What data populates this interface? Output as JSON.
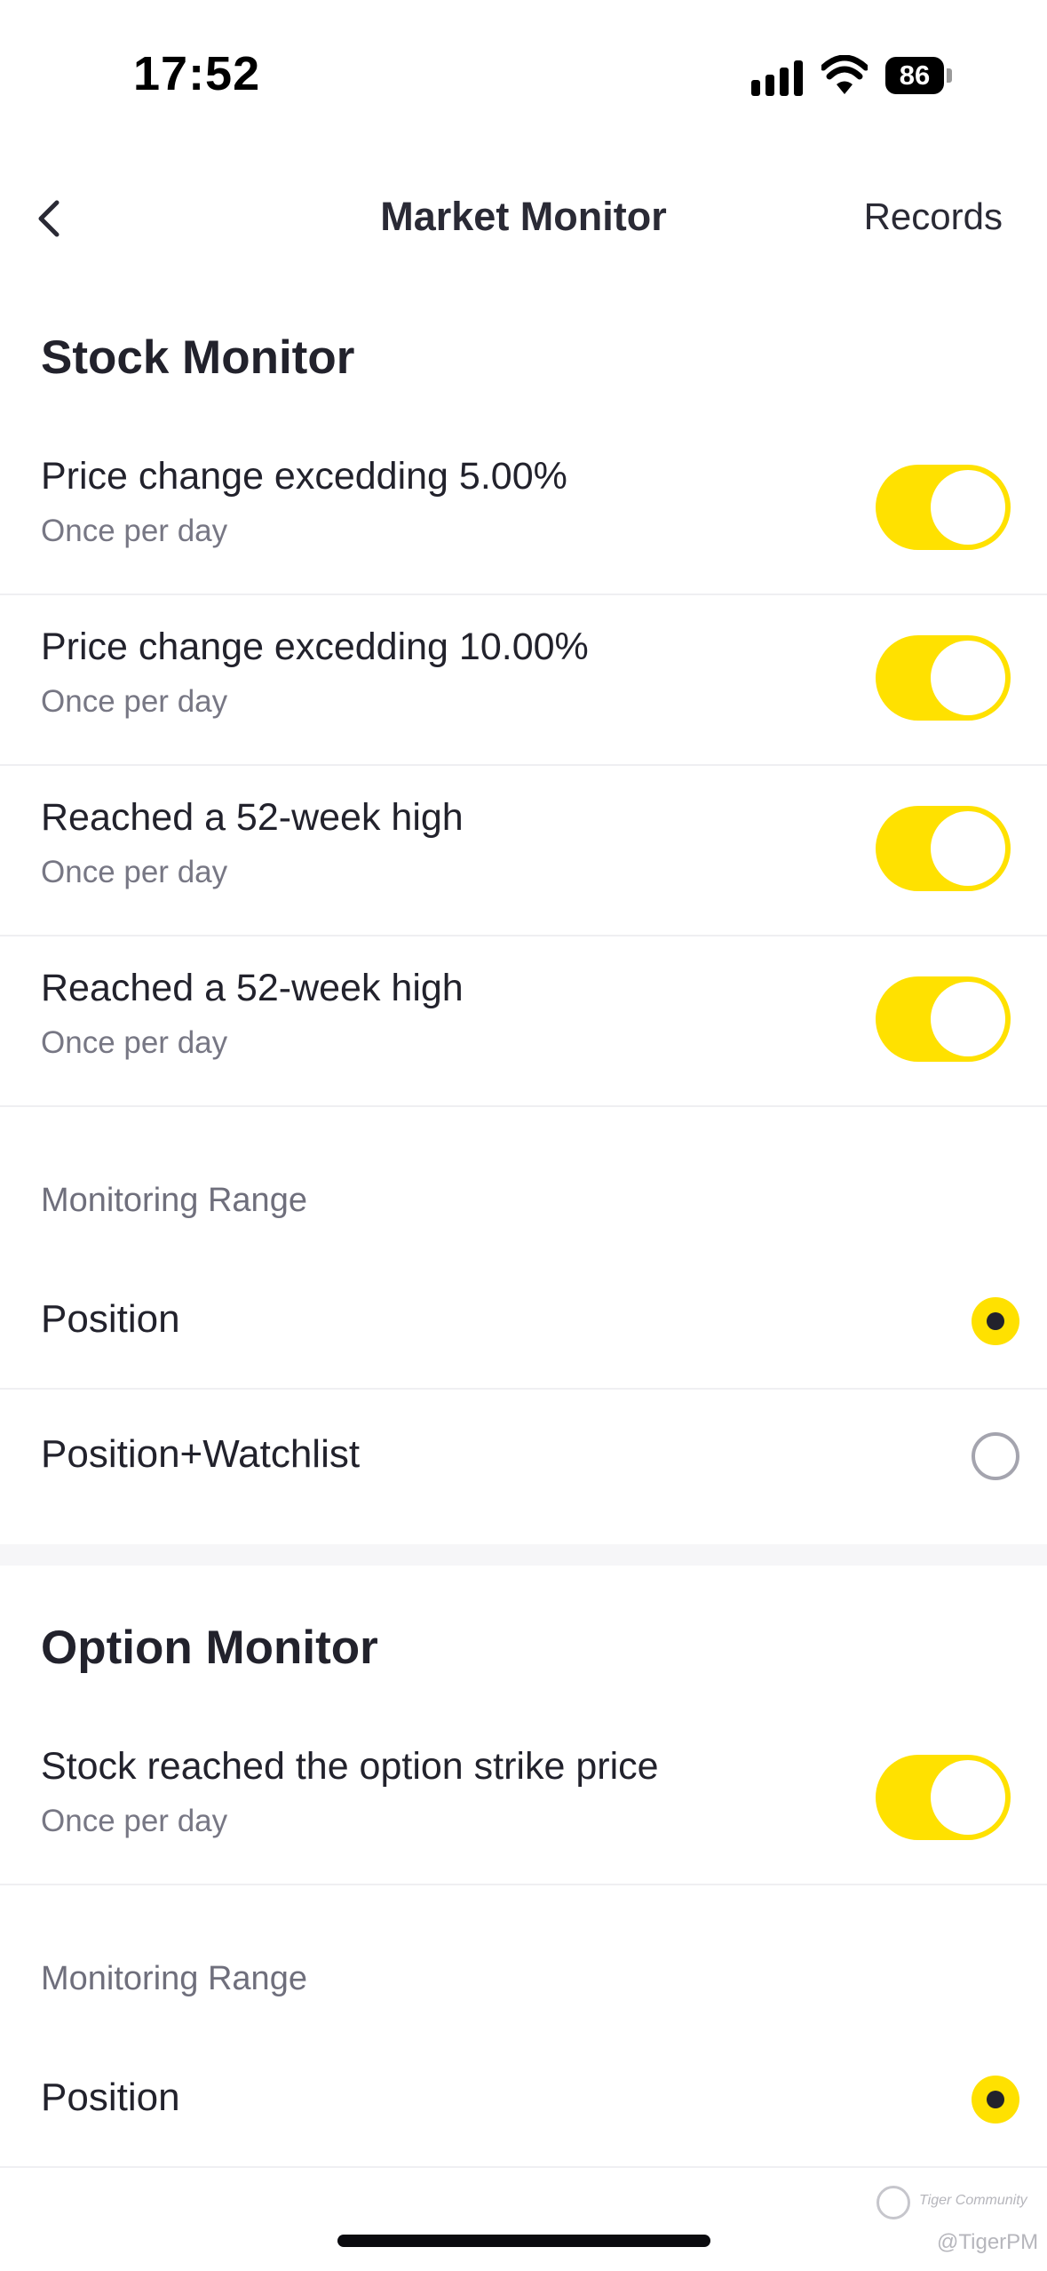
{
  "status_bar": {
    "time": "17:52",
    "battery": "86",
    "icons": [
      "signal-icon",
      "wifi-icon",
      "battery-icon"
    ]
  },
  "nav": {
    "back_icon": "chevron-left-icon",
    "title": "Market Monitor",
    "records": "Records"
  },
  "stock_monitor": {
    "title": "Stock Monitor",
    "alerts": [
      {
        "title": "Price change excedding 5.00%",
        "frequency": "Once per day",
        "enabled": true
      },
      {
        "title": "Price change excedding 10.00%",
        "frequency": "Once per day",
        "enabled": true
      },
      {
        "title": "Reached a 52-week high",
        "frequency": "Once per day",
        "enabled": true
      },
      {
        "title": "Reached a 52-week high",
        "frequency": "Once per day",
        "enabled": true
      }
    ],
    "range_label": "Monitoring Range",
    "range_options": [
      {
        "label": "Position",
        "selected": true
      },
      {
        "label": "Position+Watchlist",
        "selected": false
      }
    ]
  },
  "option_monitor": {
    "title": "Option Monitor",
    "alerts": [
      {
        "title": "Stock reached the option strike price",
        "frequency": "Once per day",
        "enabled": true
      }
    ],
    "range_label": "Monitoring Range",
    "range_options": [
      {
        "label": "Position",
        "selected": true
      }
    ]
  },
  "watermark": {
    "community": "Tiger Community",
    "handle": "@TigerPM"
  },
  "colors": {
    "accent": "#ffe100",
    "text": "#22222c",
    "secondary": "#777784"
  }
}
